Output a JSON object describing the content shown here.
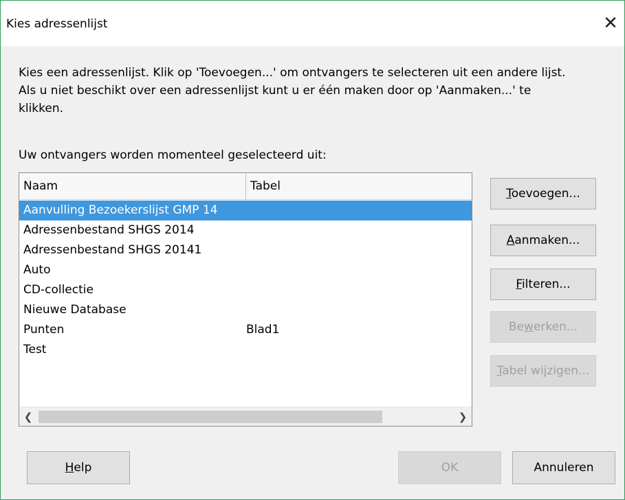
{
  "window": {
    "title": "Kies adressenlijst"
  },
  "description": {
    "line1": "Kies een adressenlijst. Klik op 'Toevoegen...' om ontvangers te selecteren uit een andere lijst.",
    "line2": "Als u niet beschikt over een adressenlijst kunt u er één maken door op 'Aanmaken...' te",
    "line3": "klikken."
  },
  "list_label": "Uw ontvangers worden momenteel geselecteerd uit:",
  "table": {
    "columns": [
      "Naam",
      "Tabel"
    ],
    "rows": [
      {
        "name": "Aanvulling Bezoekerslijst GMP 14",
        "table": "",
        "selected": true
      },
      {
        "name": "Adressenbestand SHGS 2014",
        "table": ""
      },
      {
        "name": "Adressenbestand SHGS 20141",
        "table": ""
      },
      {
        "name": "Auto",
        "table": ""
      },
      {
        "name": "CD-collectie",
        "table": ""
      },
      {
        "name": "Nieuwe Database",
        "table": ""
      },
      {
        "name": "Punten",
        "table": "Blad1"
      },
      {
        "name": "Test",
        "table": ""
      }
    ]
  },
  "buttons": {
    "add": {
      "pre": "",
      "key": "T",
      "post": "oevoegen..."
    },
    "create": {
      "pre": "",
      "key": "A",
      "post": "anmaken..."
    },
    "filter": {
      "pre": "",
      "key": "F",
      "post": "ilteren..."
    },
    "edit": {
      "pre": "Be",
      "key": "w",
      "post": "erken..."
    },
    "change_table": {
      "pre": "",
      "key": "T",
      "post": "abel wijzigen..."
    },
    "help": {
      "pre": "",
      "key": "H",
      "post": "elp"
    },
    "ok": "OK",
    "cancel": "Annuleren"
  },
  "colors": {
    "selection": "#3f97dd",
    "window_border": "#2e9b5a"
  }
}
